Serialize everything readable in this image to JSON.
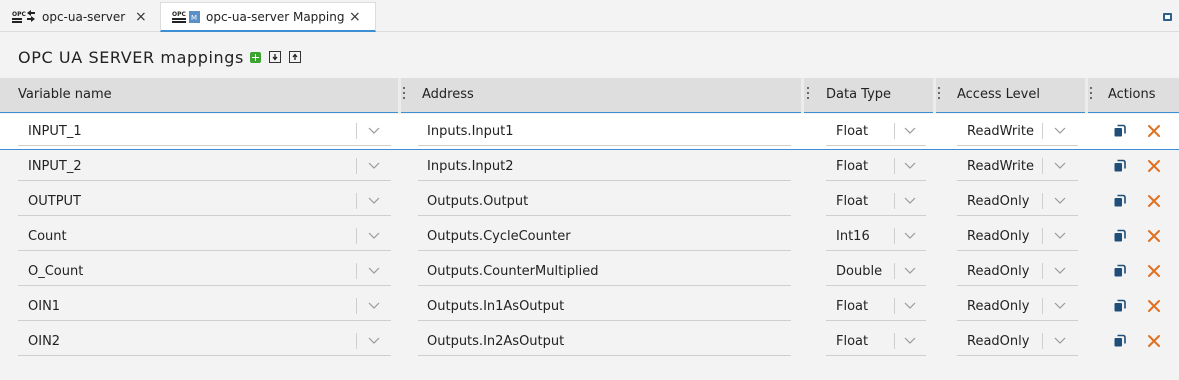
{
  "tabs": [
    {
      "label": "opc-ua-server"
    },
    {
      "label": "opc-ua-server Mapping"
    }
  ],
  "page": {
    "title": "OPC UA SERVER mappings"
  },
  "columns": {
    "variable_name": "Variable name",
    "address": "Address",
    "data_type": "Data Type",
    "access_level": "Access Level",
    "actions": "Actions"
  },
  "rows": [
    {
      "variable": "INPUT_1",
      "address": "Inputs.Input1",
      "type": "Float",
      "access": "ReadWrite"
    },
    {
      "variable": "INPUT_2",
      "address": "Inputs.Input2",
      "type": "Float",
      "access": "ReadWrite"
    },
    {
      "variable": "OUTPUT",
      "address": "Outputs.Output",
      "type": "Float",
      "access": "ReadOnly"
    },
    {
      "variable": "Count",
      "address": "Outputs.CycleCounter",
      "type": "Int16",
      "access": "ReadOnly"
    },
    {
      "variable": "O_Count",
      "address": "Outputs.CounterMultiplied",
      "type": "Double",
      "access": "ReadOnly"
    },
    {
      "variable": "OIN1",
      "address": "Outputs.In1AsOutput",
      "type": "Float",
      "access": "ReadOnly"
    },
    {
      "variable": "OIN2",
      "address": "Outputs.In2AsOutput",
      "type": "Float",
      "access": "ReadOnly"
    }
  ],
  "icons": {
    "add": "plus-icon",
    "import": "import-icon",
    "export": "export-icon",
    "copy": "copy-icon",
    "delete": "delete-icon",
    "dropdown": "chevron-down-icon",
    "column_menu": "column-menu-icon"
  },
  "colors": {
    "accent": "#3c8fd2",
    "add_button": "#3ba52f",
    "delete_icon": "#e07020",
    "copy_icon": "#1f4e79"
  }
}
